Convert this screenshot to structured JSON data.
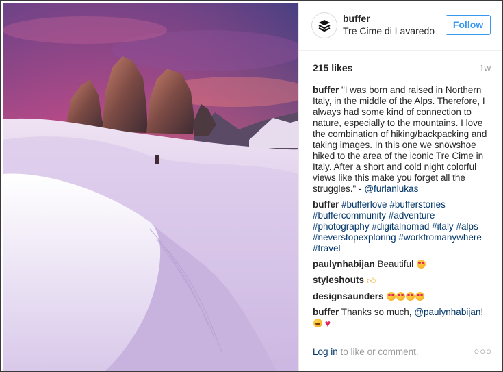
{
  "post": {
    "account": "buffer",
    "location": "Tre Cime di Lavaredo",
    "follow_label": "Follow",
    "likes": "215 likes",
    "time": "1w",
    "caption": {
      "user": "buffer",
      "text": "\"I was born and raised in Northern Italy, in the middle of the Alps. Therefore, I always had some kind of connection to nature, especially to the mountains. I love the combination of hiking/backpacking and taking images. In this one we snowshoe hiked to the area of the iconic Tre Cime in Italy. After a short and cold night colorful views like this make you forget all the struggles.\" - ",
      "mention": "@furlanlukas"
    },
    "comments": [
      {
        "user": "buffer",
        "tags": [
          "#bufferlove",
          "#bufferstories",
          "#buffercommunity",
          "#adventure",
          "#photography",
          "#digitalnomad",
          "#italy",
          "#alps",
          "#neverstopexploring",
          "#workfromanywhere",
          "#travel"
        ]
      },
      {
        "user": "paulynhabijan",
        "text": "Beautiful",
        "emoji": "heart-eyes-icon"
      },
      {
        "user": "styleshouts",
        "emoji": "thumbs-up-icon"
      },
      {
        "user": "designsaunders",
        "emoji": "heart-eyes-icon"
      },
      {
        "user": "buffer",
        "text": "Thanks so much, ",
        "mention": "@paulynhabijan",
        "suffix": "!",
        "emoji": "grin-icon"
      }
    ],
    "footer": {
      "login_label": "Log in",
      "login_suffix": " to like or comment.",
      "more_icon": "more-options-icon"
    }
  },
  "colors": {
    "link": "#003569",
    "follow": "#3897f0",
    "muted": "#999999"
  }
}
